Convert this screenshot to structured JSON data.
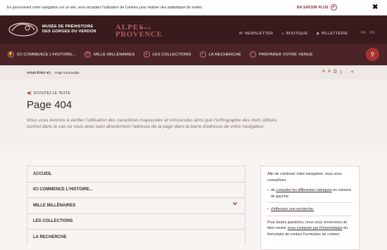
{
  "cookie": {
    "text": "En poursuivant votre navigation sur ce site, vous acceptez l'utilisation de Cookies pour réaliser des statistiques de visites.",
    "more": "EN SAVOIR PLUS",
    "close": "✖"
  },
  "header": {
    "museum_line1": "MUSÉE DE PRÉHISTOIRE",
    "museum_line2": "DES GORGES DU VERDON",
    "alpes_line1": "ALPES",
    "alpes_line2": "PROVENCE",
    "alpes_small": "DE HAUTE",
    "links": [
      "NEWSLETTER",
      "BOUTIQUE",
      "BILLETTERIE"
    ],
    "lang": [
      "FR",
      "EN"
    ]
  },
  "nav": {
    "items": [
      "ICI COMMENCE L'HISTOIRE...",
      "MILLE MILLÉNAIRES",
      "LES COLLECTIONS",
      "LA RECHERCHE",
      "PRÉPARER VOTRE VENUE"
    ]
  },
  "breadcrumb": {
    "label": "VOUS ÊTES ICI :",
    "current": "Page introuvable"
  },
  "page": {
    "listen": "ECOUTEZ LE TEXTE",
    "title": "Page 404",
    "intro": "Vous vous invitons à vérifier l'utilisation des caractères majuscules et minuscules ainsi que l'orthographe des mots utilisés, surtout dans le cas où vous avez saisi directement l'adresse de la page dans la barre d'adresse de votre navigateur."
  },
  "list": [
    "ACCUEIL",
    "ICI COMMENCE L'HISTOIRE...",
    "MILLE MILLÉNAIRES",
    "LES COLLECTIONS",
    "LA RECHERCHE"
  ],
  "aside": {
    "intro": "Afin de continuer votre navigation, nous vous conseillons :",
    "b1a": "de ",
    "b1link": "consulter les différentes rubriques",
    "b1b": " en colonne de gauche;",
    "b2link": "d'effectuer une recherche;",
    "p1": "Pour toutes questions, nous vous remercions de bien vouloir ",
    "p1link": "nous contacter par l'intermédiaire",
    "p2": " du formulaire de contact Formulaire de contact ."
  }
}
